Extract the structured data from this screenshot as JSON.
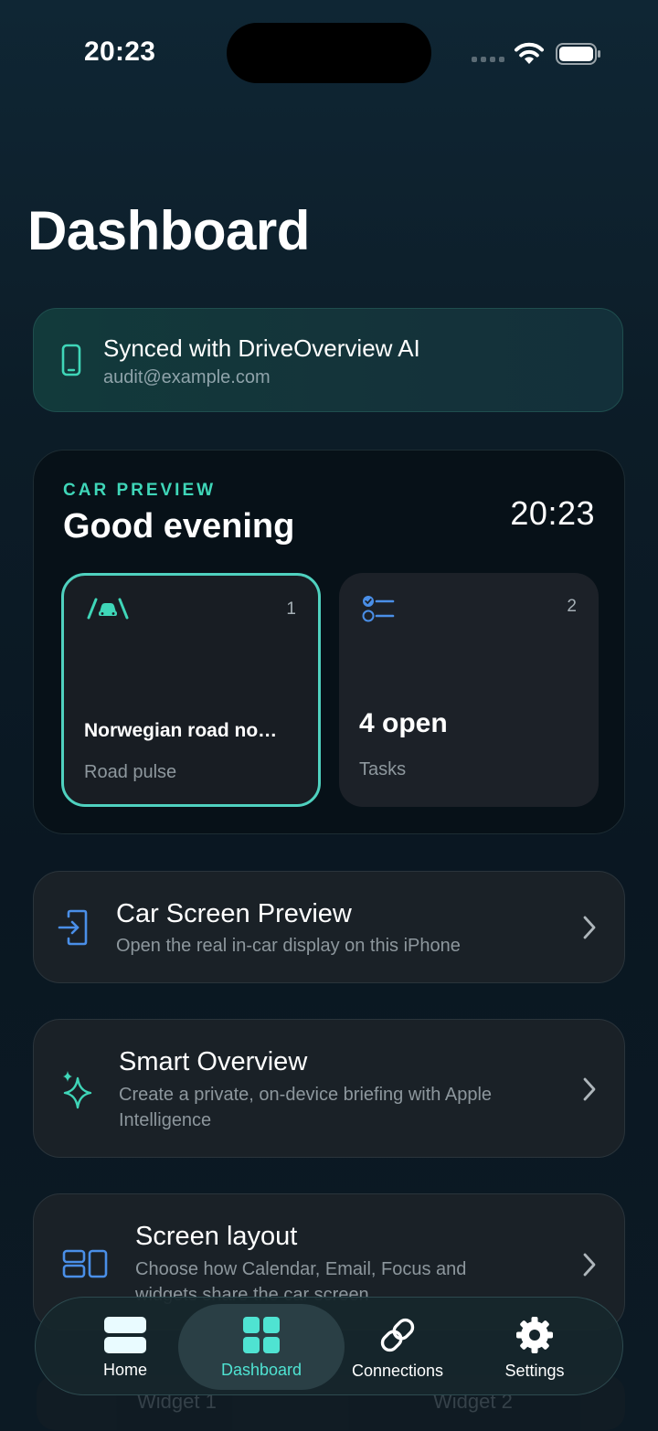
{
  "status_bar": {
    "time": "20:23"
  },
  "header": {
    "title": "Dashboard"
  },
  "sync": {
    "title": "Synced with DriveOverview AI",
    "email": "audit@example.com"
  },
  "car_preview": {
    "eyebrow": "CAR PREVIEW",
    "greeting": "Good evening",
    "clock": "20:23",
    "tiles": [
      {
        "index": "1",
        "headline": "Norwegian road no…",
        "caption": "Road pulse",
        "icon": "road-car-icon"
      },
      {
        "index": "2",
        "headline": "4 open",
        "caption": "Tasks",
        "icon": "checklist-icon"
      }
    ]
  },
  "rows": [
    {
      "title": "Car Screen Preview",
      "subtitle": "Open the real in-car display on this iPhone",
      "icon": "enter-screen-icon"
    },
    {
      "title": "Smart Overview",
      "subtitle": "Create a private, on-device briefing with Apple Intelligence",
      "icon": "sparkles-icon"
    },
    {
      "title": "Screen layout",
      "subtitle": "Choose how Calendar, Email, Focus and widgets share the car screen",
      "icon": "layout-icon"
    }
  ],
  "widgets": {
    "left": "Widget 1",
    "right": "Widget 2"
  },
  "tabbar": {
    "active": "Dashboard",
    "tabs": [
      {
        "label": "Home",
        "icon": "home-icon"
      },
      {
        "label": "Dashboard",
        "icon": "grid-icon"
      },
      {
        "label": "Connections",
        "icon": "link-icon"
      },
      {
        "label": "Settings",
        "icon": "gear-icon"
      }
    ]
  },
  "colors": {
    "accent": "#3fd6b8",
    "tab_active": "#4fe3d2",
    "row_icon": "#4a8fe8"
  }
}
